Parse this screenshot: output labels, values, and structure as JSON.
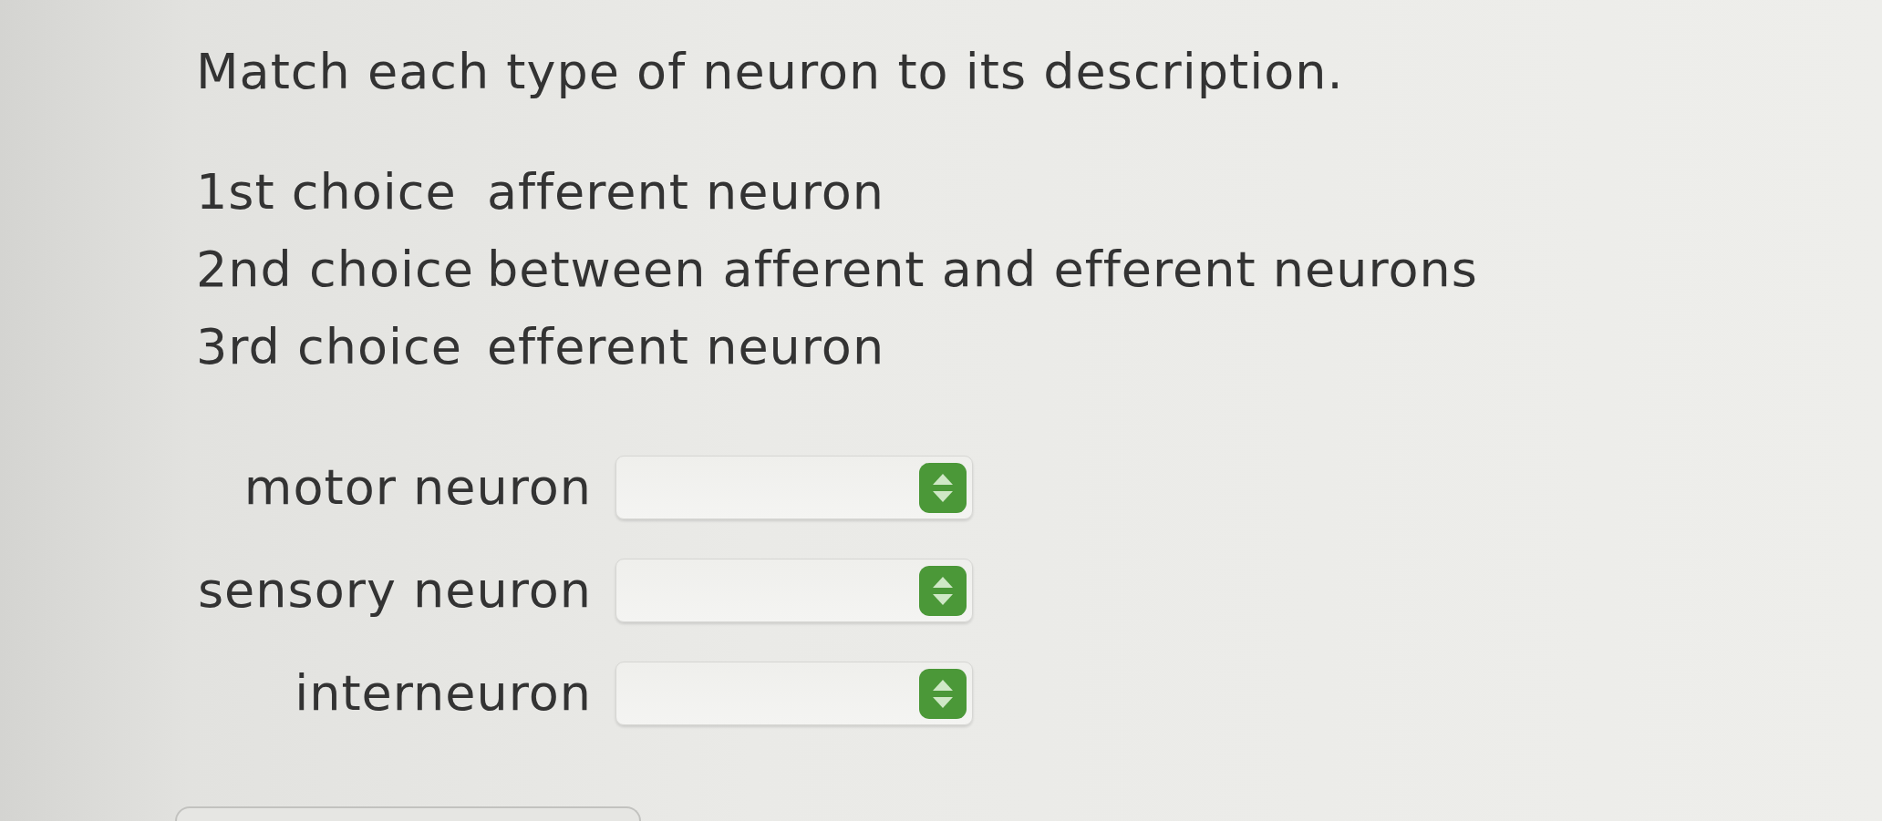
{
  "question": {
    "prompt": "Match each type of neuron to its description."
  },
  "choices": [
    {
      "label": "1st choice",
      "description": "afferent neuron"
    },
    {
      "label": "2nd choice",
      "description": "between afferent and efferent neurons"
    },
    {
      "label": "3rd choice",
      "description": "efferent neuron"
    }
  ],
  "matches": [
    {
      "term": "motor neuron"
    },
    {
      "term": "sensory neuron"
    },
    {
      "term": "interneuron"
    }
  ]
}
